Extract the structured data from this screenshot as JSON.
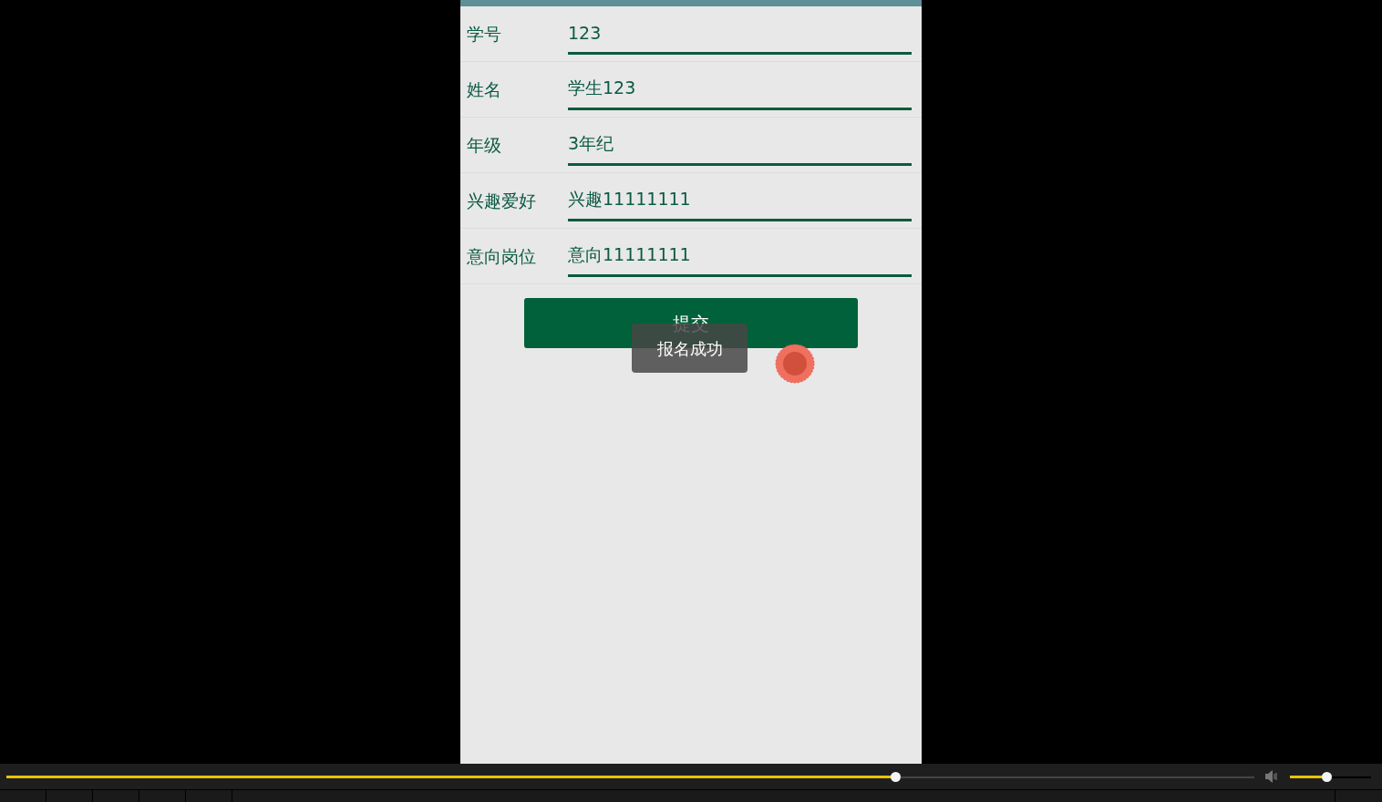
{
  "form": {
    "fields": [
      {
        "label": "学号",
        "value": "123"
      },
      {
        "label": "姓名",
        "value": "学生123"
      },
      {
        "label": "年级",
        "value": "3年纪"
      },
      {
        "label": "兴趣爱好",
        "value": "兴趣11111111"
      },
      {
        "label": "意向岗位",
        "value": "意向11111111"
      }
    ],
    "submit_button": "提交"
  },
  "toast": "报名成功",
  "player": {
    "seek": {
      "level": 0.712
    },
    "volume": {
      "level": 0.45
    }
  }
}
